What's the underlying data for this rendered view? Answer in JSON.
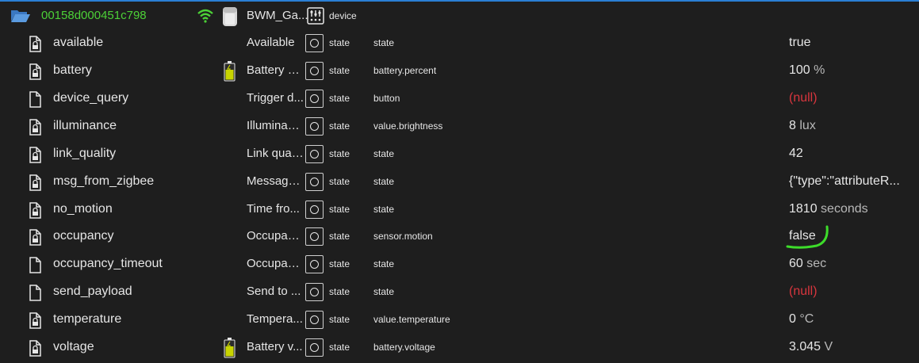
{
  "colors": {
    "accent": "#2a7fd4",
    "device_id": "#4cd137",
    "null_value": "#d9363e",
    "highlight": "#3ddc2a",
    "battery": "#c8d400"
  },
  "header": {
    "device_id": "00158d000451c798",
    "device_name": "BWM_Ga...",
    "role": "device",
    "icons": [
      "folder-open-icon",
      "wifi-icon",
      "motion-sensor-icon",
      "device-role-icon"
    ]
  },
  "rows": [
    {
      "name": "available",
      "description": "Available",
      "type": "state",
      "role": "state",
      "value": "true",
      "unit": "",
      "icon": "file-lock-icon",
      "battery_icon": false
    },
    {
      "name": "battery",
      "description": "Battery p...",
      "type": "state",
      "role": "battery.percent",
      "value": "100",
      "unit": "%",
      "icon": "file-lock-icon",
      "battery_icon": true
    },
    {
      "name": "device_query",
      "description": "Trigger d...",
      "type": "state",
      "role": "button",
      "value": "(null)",
      "unit": "",
      "icon": "file-icon",
      "battery_icon": false
    },
    {
      "name": "illuminance",
      "description": "Illuminan...",
      "type": "state",
      "role": "value.brightness",
      "value": "8",
      "unit": "lux",
      "icon": "file-lock-icon",
      "battery_icon": false
    },
    {
      "name": "link_quality",
      "description": "Link qual...",
      "type": "state",
      "role": "state",
      "value": "42",
      "unit": "",
      "icon": "file-lock-icon",
      "battery_icon": false
    },
    {
      "name": "msg_from_zigbee",
      "description": "Message...",
      "type": "state",
      "role": "state",
      "value": "{\"type\":\"attributeR...",
      "unit": "",
      "icon": "file-lock-icon",
      "battery_icon": false
    },
    {
      "name": "no_motion",
      "description": "Time fro...",
      "type": "state",
      "role": "state",
      "value": "1810",
      "unit": "seconds",
      "icon": "file-lock-icon",
      "battery_icon": false
    },
    {
      "name": "occupancy",
      "description": "Occupan...",
      "type": "state",
      "role": "sensor.motion",
      "value": "false",
      "unit": "",
      "icon": "file-lock-icon",
      "battery_icon": false
    },
    {
      "name": "occupancy_timeout",
      "description": "Occupan...",
      "type": "state",
      "role": "state",
      "value": "60",
      "unit": "sec",
      "icon": "file-icon",
      "battery_icon": false
    },
    {
      "name": "send_payload",
      "description": "Send to ...",
      "type": "state",
      "role": "state",
      "value": "(null)",
      "unit": "",
      "icon": "file-icon",
      "battery_icon": false
    },
    {
      "name": "temperature",
      "description": "Tempera...",
      "type": "state",
      "role": "value.temperature",
      "value": "0",
      "unit": "°C",
      "icon": "file-lock-icon",
      "battery_icon": false
    },
    {
      "name": "voltage",
      "description": "Battery v...",
      "type": "state",
      "role": "battery.voltage",
      "value": "3.045",
      "unit": "V",
      "icon": "file-lock-icon",
      "battery_icon": true
    }
  ]
}
